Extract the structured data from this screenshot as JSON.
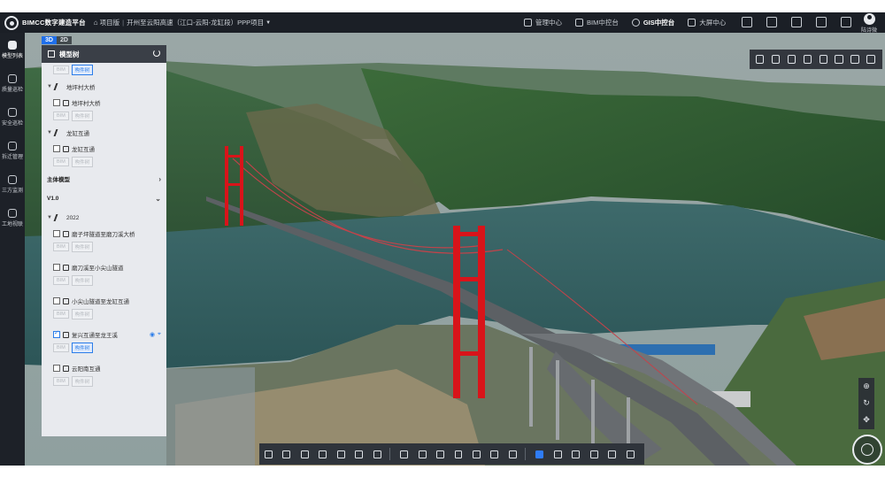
{
  "header": {
    "app_name": "BIMCC数字建造平台",
    "project_label": "项目版",
    "project_name": "开州至云阳高速（江口-云阳-龙缸段）PPP项目",
    "nav": [
      {
        "label": "管理中心",
        "icon": "grid-icon"
      },
      {
        "label": "BIM中控台",
        "icon": "cube-icon"
      },
      {
        "label": "GIS中控台",
        "icon": "globe-icon",
        "active": true
      },
      {
        "label": "大屏中心",
        "icon": "screen-icon"
      }
    ],
    "tool_icons": [
      "message-icon",
      "calendar-icon",
      "document-icon",
      "notes-icon",
      "fullscreen-icon"
    ],
    "user_name": "陆诗微"
  },
  "leftnav": [
    {
      "label": "模型列表",
      "icon": "cube-icon",
      "active": true
    },
    {
      "label": "质量巡检",
      "icon": "shield-icon"
    },
    {
      "label": "安全巡检",
      "icon": "safety-icon"
    },
    {
      "label": "拆迁管理",
      "icon": "relocation-icon"
    },
    {
      "label": "三方监测",
      "icon": "monitor-icon"
    },
    {
      "label": "工地视联",
      "icon": "camera-icon"
    }
  ],
  "view_tabs": [
    "3D",
    "2D"
  ],
  "panel": {
    "title": "模型树",
    "tag_bim": "BIM",
    "tag_component": "构件树",
    "groups_top": [
      {
        "name": "地坪村大桥",
        "leaf": "地坪村大桥"
      },
      {
        "name": "龙缸互通",
        "leaf": "龙缸互通"
      }
    ],
    "section_main": "主体模型",
    "section_version": "V1.0",
    "year_group": "2022",
    "items": [
      {
        "name": "磨子坪隧道至磨刀溪大桥",
        "checked": false,
        "component_on": false
      },
      {
        "name": "磨刀溪至小尖山隧道",
        "checked": false,
        "component_on": false
      },
      {
        "name": "小尖山隧道至龙缸互通",
        "checked": false,
        "component_on": false
      },
      {
        "name": "复兴互通至龙王溪",
        "checked": true,
        "component_on": true
      },
      {
        "name": "云阳南互通",
        "checked": false,
        "component_on": false
      }
    ]
  },
  "right_toolbar": [
    "home-view-icon",
    "layers-icon",
    "compass-icon",
    "image-icon",
    "flag-icon",
    "model-icon",
    "eye-icon",
    "settings-icon"
  ],
  "right_side_controls": [
    "locate-icon",
    "rotate-icon",
    "move-icon"
  ],
  "bottom_toolbar": {
    "group1": [
      "measure-icon",
      "pin-icon",
      "area-icon",
      "split-icon",
      "send-icon",
      "snow-icon",
      "clip-icon"
    ],
    "group2": [
      "select-icon",
      "frame-icon",
      "table-icon",
      "box-icon",
      "list-icon",
      "profile-icon",
      "settings-icon"
    ],
    "group3": [
      "layer-icon",
      "eye-icon",
      "hide-icon",
      "target-icon",
      "warning-icon",
      "drag-icon"
    ]
  },
  "colors": {
    "topbar": "#1b1f26",
    "accent": "#1f6feb",
    "bridge_tower": "#d8141a",
    "water": "#2f5a5c"
  }
}
